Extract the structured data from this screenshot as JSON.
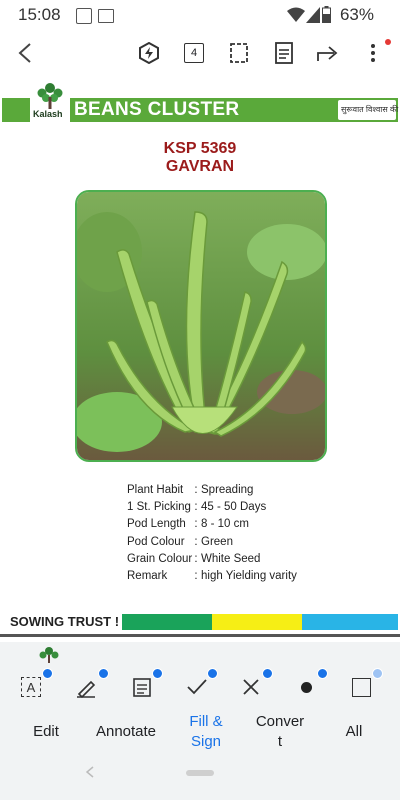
{
  "status_bar": {
    "time": "15:08",
    "battery": "63%"
  },
  "toolbar": {
    "page_count": "4"
  },
  "document": {
    "brand": "Kalash",
    "band_title": "BEANS CLUSTER",
    "sign_text": "सुरूवात विश्वास की",
    "product_code": "KSP 5369",
    "product_name": "GAVRAN",
    "specs": [
      {
        "key": "Plant Habit",
        "value": "Spreading"
      },
      {
        "key": "1 St. Picking",
        "value": "45 - 50 Days"
      },
      {
        "key": "Pod Length",
        "value": "8 - 10 cm"
      },
      {
        "key": "Pod Colour",
        "value": "Green"
      },
      {
        "key": "Grain Colour",
        "value": "White Seed"
      },
      {
        "key": "Remark",
        "value": "high Yielding varity"
      }
    ],
    "colon": ":",
    "tagline": "SOWING TRUST !",
    "tagline_colors": [
      "#1aa35a",
      "#f6ee15",
      "#29b4e6"
    ]
  },
  "bottom_tabs": {
    "edit": "Edit",
    "annotate": "Annotate",
    "fill_sign_1": "Fill &",
    "fill_sign_2": "Sign",
    "convert_1": "Conver",
    "convert_2": "t",
    "all": "All"
  },
  "colors": {
    "accent": "#1a73e8",
    "band": "#5aa93a",
    "title": "#9b1b1b"
  }
}
